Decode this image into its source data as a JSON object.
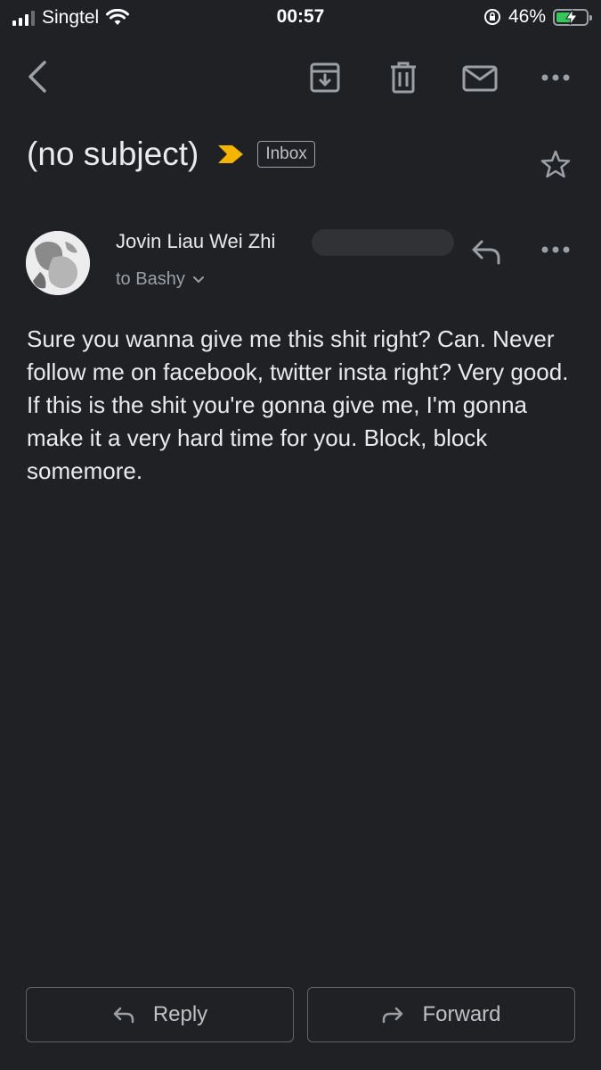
{
  "status_bar": {
    "carrier": "Singtel",
    "time": "00:57",
    "battery_percent": "46%",
    "battery_level": 0.46,
    "charging": true,
    "icons": [
      "signal-icon",
      "wifi-icon",
      "orientation-lock-icon",
      "battery-icon"
    ]
  },
  "toolbar": {
    "icons": [
      "back-icon",
      "archive-icon",
      "delete-icon",
      "mark-unread-icon",
      "more-icon"
    ]
  },
  "email": {
    "subject": "(no subject)",
    "label": "Inbox",
    "sender_name": "Jovin Liau Wei Zhi",
    "recipient": "to Bashy",
    "body": "Sure you wanna give me this shit right? Can. Never follow me on facebook, twitter insta right? Very good. If this is the shit you're gonna give me, I'm gonna make it a very hard time for you. Block, block somemore."
  },
  "actions": {
    "reply_label": "Reply",
    "forward_label": "Forward"
  },
  "colors": {
    "background": "#202124",
    "importance_marker": "#f4b400",
    "battery_charging": "#34c759"
  }
}
